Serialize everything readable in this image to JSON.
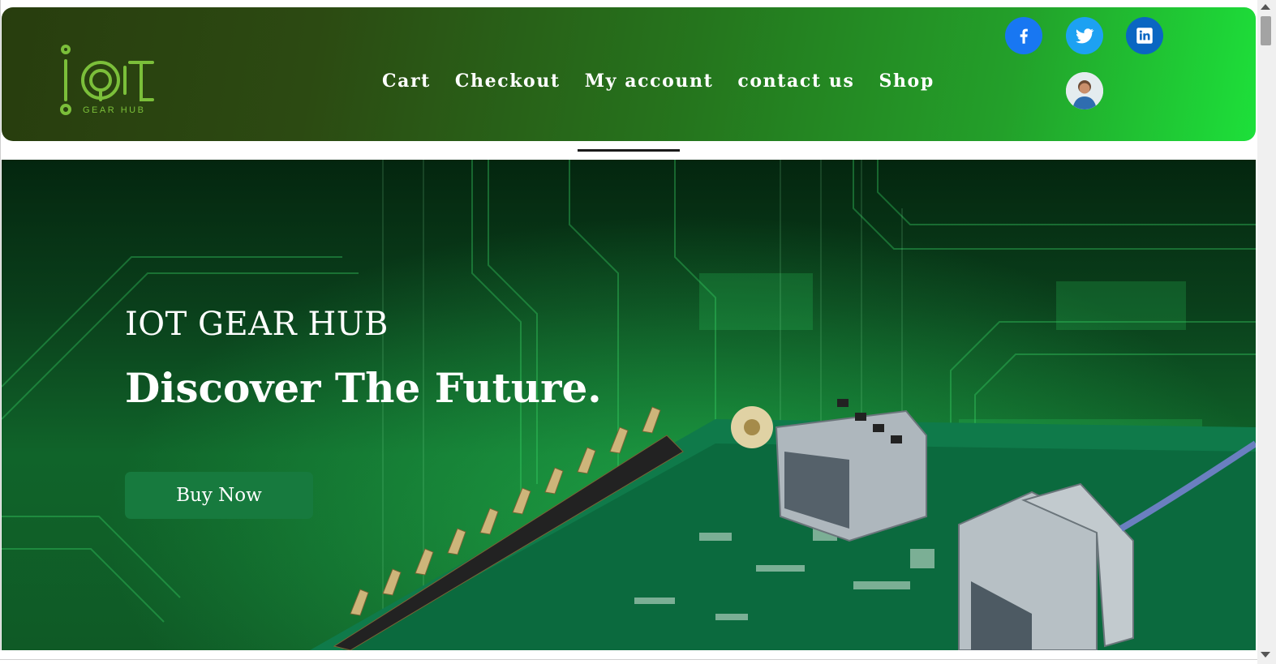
{
  "header": {
    "logo": {
      "mark": "iot",
      "tagline": "GEAR HUB"
    },
    "nav": [
      {
        "label": "Cart"
      },
      {
        "label": "Checkout"
      },
      {
        "label": "My account"
      },
      {
        "label": "contact us"
      },
      {
        "label": "Shop"
      }
    ],
    "social": [
      {
        "icon": "facebook-icon",
        "color": "#1877f2"
      },
      {
        "icon": "twitter-icon",
        "color": "#1da1f2"
      },
      {
        "icon": "linkedin-icon",
        "color": "#0a66c2"
      }
    ],
    "gradient": [
      "#283d0e",
      "#1de03a"
    ]
  },
  "hero": {
    "title": "IOT GEAR HUB",
    "subtitle": "Discover The Future.",
    "button_label": "Buy Now",
    "button_color": "#177a3e"
  }
}
